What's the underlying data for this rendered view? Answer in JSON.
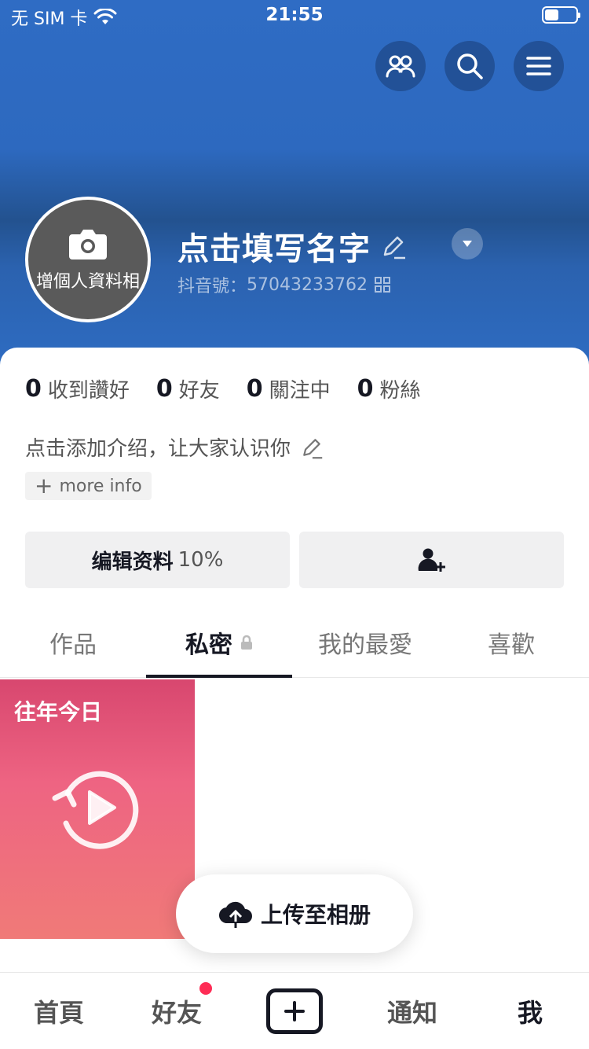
{
  "status_bar": {
    "carrier": "无 SIM 卡",
    "time": "21:55",
    "battery_level": 0.45
  },
  "header": {
    "actions": [
      {
        "icon": "people-icon"
      },
      {
        "icon": "search-icon"
      },
      {
        "icon": "menu-icon"
      }
    ]
  },
  "profile": {
    "avatar_label": "增個人資料相",
    "name": "点击填写名字",
    "id_label": "抖音號：",
    "id_value": "57043233762"
  },
  "stats": [
    {
      "value": "0",
      "label": "收到讚好"
    },
    {
      "value": "0",
      "label": "好友"
    },
    {
      "value": "0",
      "label": "關注中"
    },
    {
      "value": "0",
      "label": "粉絲"
    }
  ],
  "bio": {
    "text": "点击添加介绍，让大家认识你",
    "more_info": "more info"
  },
  "buttons": {
    "edit_profile": "编辑资料",
    "edit_progress": "10%"
  },
  "tabs": [
    {
      "label": "作品",
      "active": false
    },
    {
      "label": "私密",
      "active": true
    },
    {
      "label": "我的最愛",
      "active": false
    },
    {
      "label": "喜歡",
      "active": false
    }
  ],
  "memory": {
    "title": "往年今日"
  },
  "upload": {
    "label": "上传至相册"
  },
  "bottom_nav": [
    {
      "label": "首頁"
    },
    {
      "label": "好友"
    },
    {
      "label": ""
    },
    {
      "label": "通知"
    },
    {
      "label": "我"
    }
  ],
  "colors": {
    "header_blue": "#2e6cc2",
    "accent_red": "#fe2c55",
    "memory_pink": "#ee6482"
  }
}
